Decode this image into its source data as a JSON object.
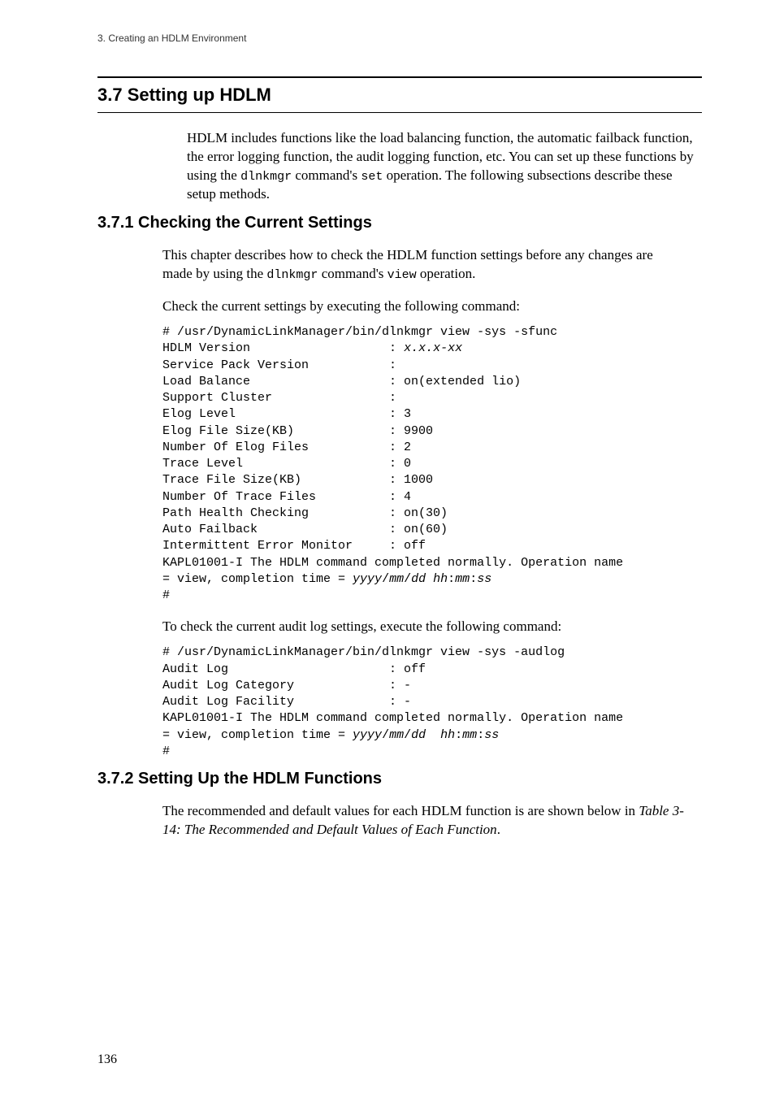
{
  "running_header": "3.  Creating an HDLM Environment",
  "h2": "3.7  Setting up HDLM",
  "intro_part1": "HDLM includes functions like the load balancing function, the automatic failback function, the error logging function, the audit logging function, etc. You can set up these functions by using the ",
  "intro_cmd": "dlnkmgr",
  "intro_part2": " command's ",
  "intro_op": "set",
  "intro_part3": " operation. The following subsections describe these setup methods.",
  "h3_1": "3.7.1  Checking the Current Settings",
  "p1_part1": "This chapter describes how to check the HDLM function settings before any changes are made by using the ",
  "p1_cmd": "dlnkmgr",
  "p1_part2": " command's ",
  "p1_op": "view",
  "p1_part3": " operation.",
  "p2": "Check the current settings by executing the following command:",
  "code1_pre": "# /usr/DynamicLinkManager/bin/dlnkmgr view -sys -sfunc\nHDLM Version                   : ",
  "code1_version": "x.x.x-xx",
  "code1_mid": "\nService Pack Version           :\nLoad Balance                   : on(extended lio)\nSupport Cluster                :\nElog Level                     : 3\nElog File Size(KB)             : 9900\nNumber Of Elog Files           : 2\nTrace Level                    : 0\nTrace File Size(KB)            : 1000\nNumber Of Trace Files          : 4\nPath Health Checking           : on(30)\nAuto Failback                  : on(60)\nIntermittent Error Monitor     : off\nKAPL01001-I The HDLM command completed normally. Operation name \n= view, completion time = ",
  "code1_dt": "yyyy",
  "code1_sl1": "/",
  "code1_mm": "mm",
  "code1_sl2": "/",
  "code1_dd": "dd",
  "code1_sp": " ",
  "code1_hh": "hh",
  "code1_c1": ":",
  "code1_mm2": "mm",
  "code1_c2": ":",
  "code1_ss": "ss",
  "code1_end": "\n#",
  "p3": "To check the current audit log settings, execute the following command:",
  "code2_pre": "# /usr/DynamicLinkManager/bin/dlnkmgr view -sys -audlog\nAudit Log                      : off\nAudit Log Category             : -\nAudit Log Facility             : -\nKAPL01001-I The HDLM command completed normally. Operation name \n= view, completion time = ",
  "code2_dt": "yyyy",
  "code2_sl1": "/",
  "code2_mm": "mm",
  "code2_sl2": "/",
  "code2_dd": "dd",
  "code2_sp": "  ",
  "code2_hh": "hh",
  "code2_c1": ":",
  "code2_mm2": "mm",
  "code2_c2": ":",
  "code2_ss": "ss",
  "code2_end": "\n#",
  "h3_2": "3.7.2  Setting Up the HDLM Functions",
  "p4_part1": "The recommended and default values for each HDLM function is are shown below in ",
  "p4_ref": "Table 3-14: The Recommended and Default Values of Each Function",
  "p4_part2": ".",
  "page_number": "136"
}
